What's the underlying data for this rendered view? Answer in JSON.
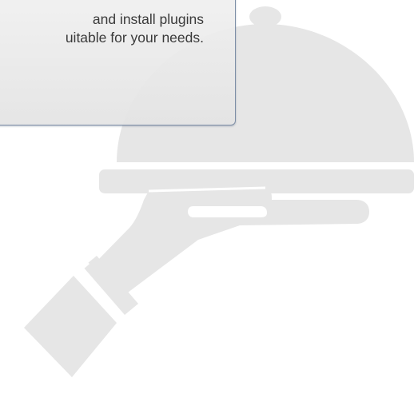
{
  "tooltip": {
    "line1": "and install plugins",
    "line2": "uitable for your needs."
  },
  "illustration": {
    "icon": "serving-cloche-hand-icon",
    "color": "#e6e6e6"
  }
}
